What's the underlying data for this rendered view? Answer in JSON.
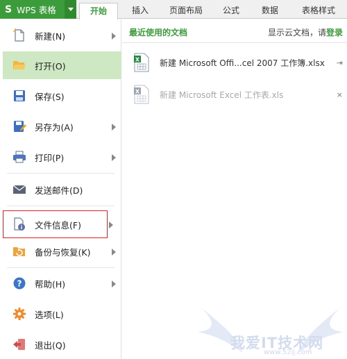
{
  "app": {
    "logo_glyph": "S",
    "title": "WPS 表格",
    "brand_color": "#3c9b3a"
  },
  "tabs": [
    {
      "label": "开始",
      "active": true
    },
    {
      "label": "插入",
      "active": false
    },
    {
      "label": "页面布局",
      "active": false
    },
    {
      "label": "公式",
      "active": false
    },
    {
      "label": "数据",
      "active": false
    },
    {
      "label": "表格样式",
      "active": false
    }
  ],
  "menu": {
    "items": [
      {
        "label": "新建(N)",
        "icon": "new-document-icon",
        "has_submenu": true
      },
      {
        "label": "打开(O)",
        "icon": "open-folder-icon",
        "has_submenu": false,
        "selected": true
      },
      {
        "label": "保存(S)",
        "icon": "save-icon",
        "has_submenu": false
      },
      {
        "label": "另存为(A)",
        "icon": "save-as-icon",
        "has_submenu": true
      },
      {
        "label": "打印(P)",
        "icon": "printer-icon",
        "has_submenu": true
      },
      {
        "label": "发送邮件(D)",
        "icon": "mail-icon",
        "has_submenu": false
      },
      {
        "label": "文件信息(F)",
        "icon": "file-info-icon",
        "has_submenu": true,
        "highlighted": true
      },
      {
        "label": "备份与恢复(K)",
        "icon": "backup-icon",
        "has_submenu": true
      },
      {
        "label": "帮助(H)",
        "icon": "help-icon",
        "has_submenu": true
      },
      {
        "label": "选项(L)",
        "icon": "gear-icon",
        "has_submenu": false
      },
      {
        "label": "退出(Q)",
        "icon": "exit-icon",
        "has_submenu": false
      }
    ]
  },
  "recent": {
    "title": "最近使用的文档",
    "cloud_text": "显示云文档，请",
    "login_label": "登录",
    "files": [
      {
        "name": "新建 Microsoft Offi...cel 2007 工作簿.xlsx",
        "icon": "excel-file-icon",
        "action_icon": "pin-icon",
        "action": "⇥",
        "dim": false
      },
      {
        "name": "新建 Microsoft Excel 工作表.xls",
        "icon": "excel-file-icon",
        "action_icon": "close-icon",
        "action": "×",
        "dim": true
      }
    ]
  },
  "watermark": {
    "text": "我爱IT技术网",
    "url": "www.52ij.com"
  }
}
